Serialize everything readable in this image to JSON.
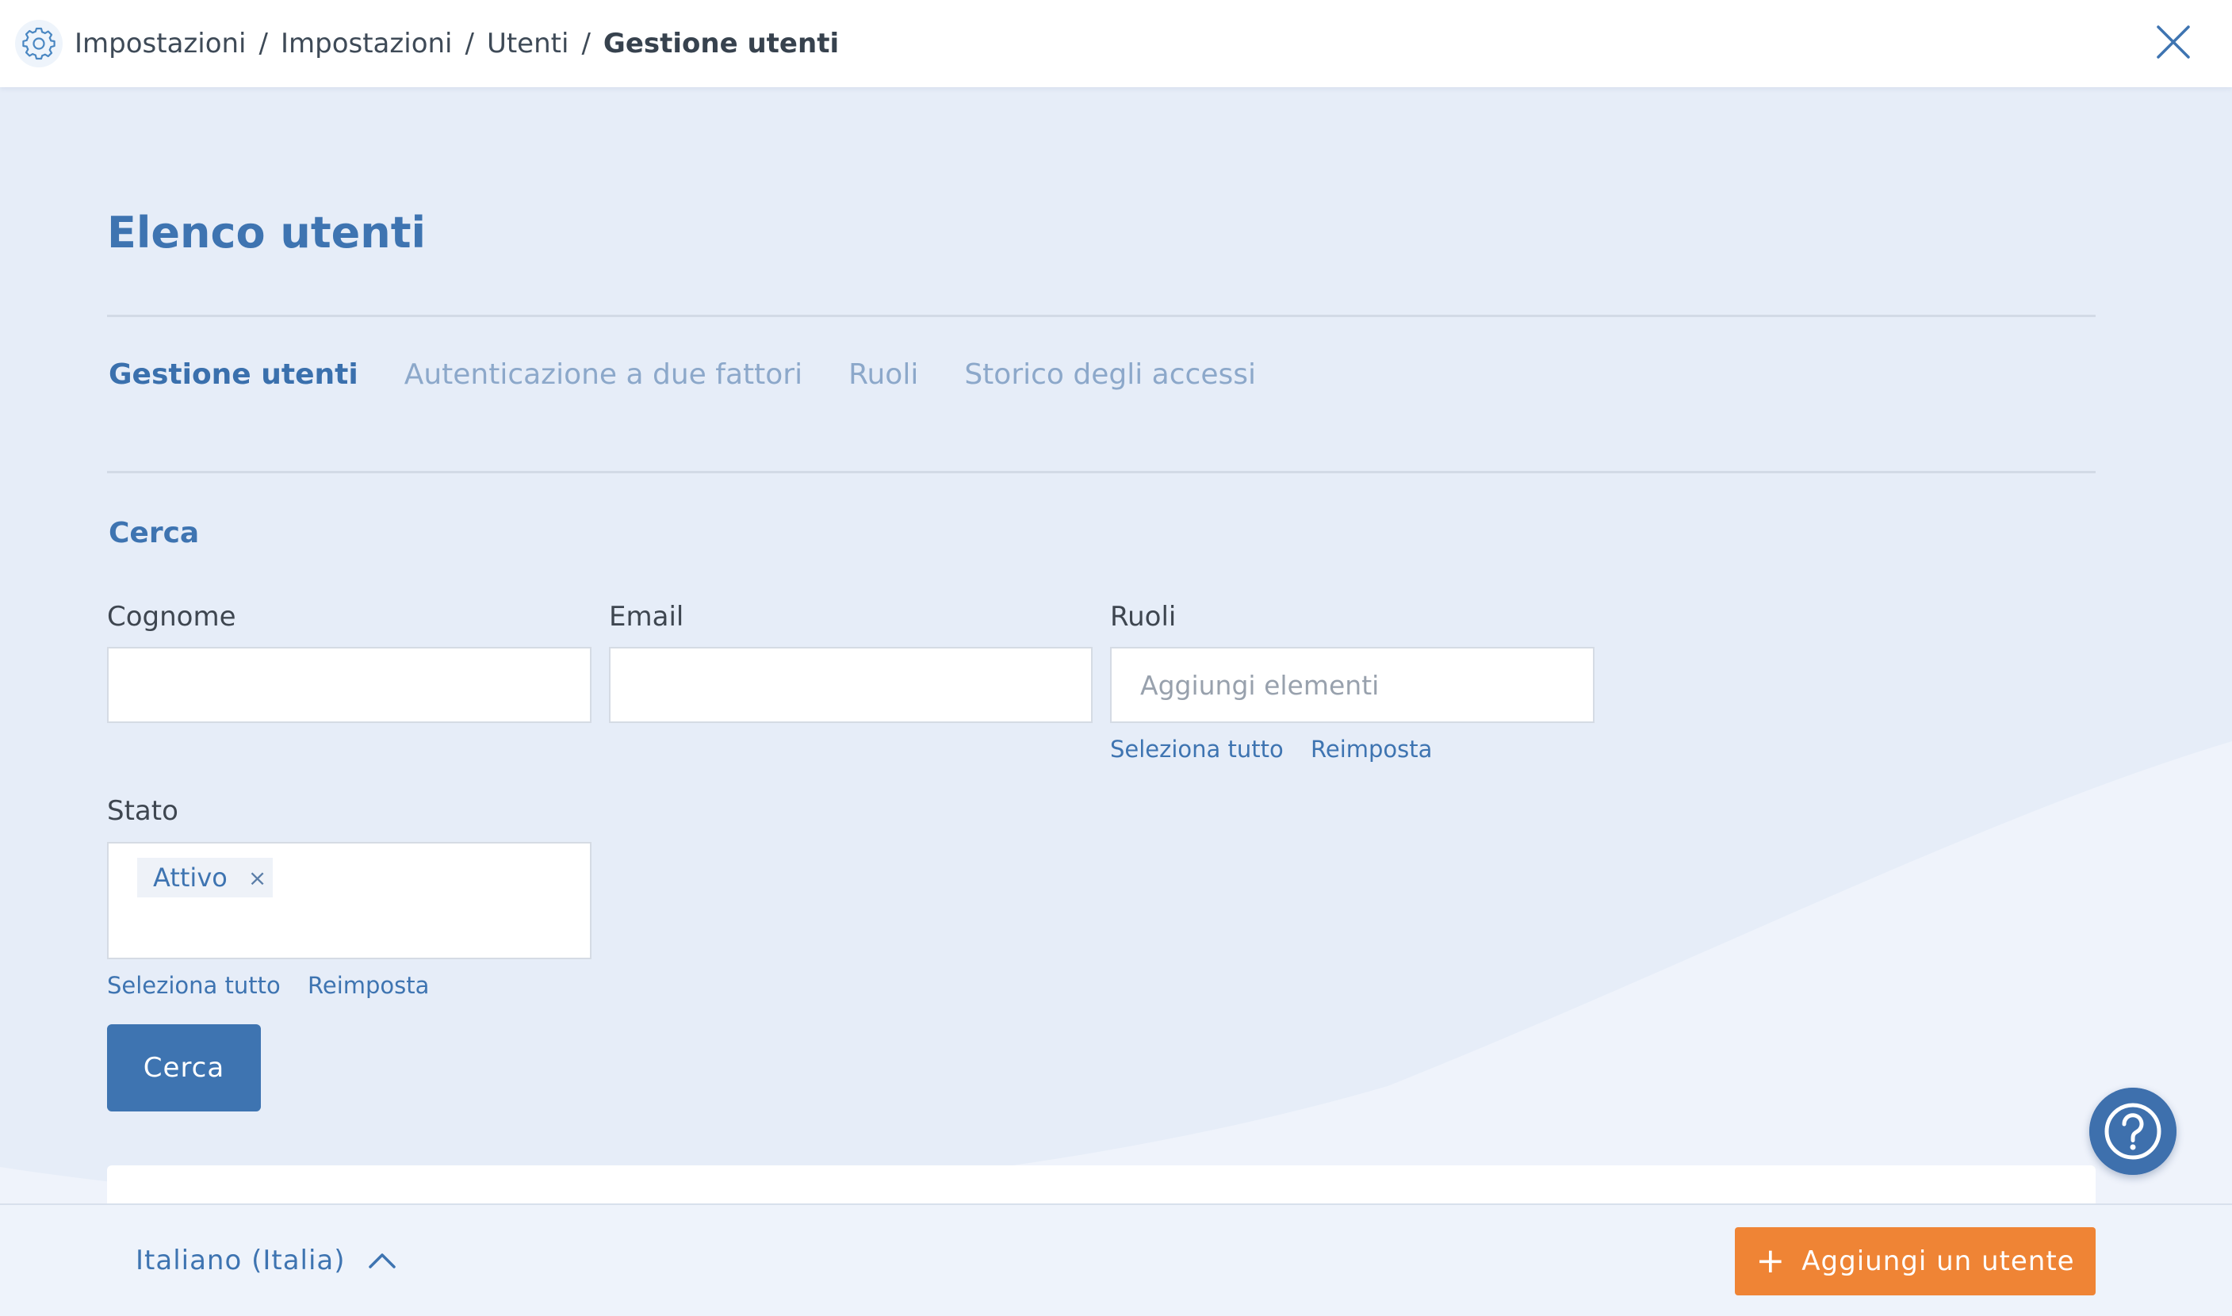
{
  "breadcrumb": {
    "items": [
      "Impostazioni",
      "Impostazioni",
      "Utenti"
    ],
    "separator": "/",
    "current": "Gestione utenti"
  },
  "page": {
    "title": "Elenco utenti"
  },
  "tabs": [
    {
      "label": "Gestione utenti",
      "active": true
    },
    {
      "label": "Autenticazione a due fattori",
      "active": false
    },
    {
      "label": "Ruoli",
      "active": false
    },
    {
      "label": "Storico degli accessi",
      "active": false
    }
  ],
  "search": {
    "section_title": "Cerca",
    "cognome": {
      "label": "Cognome",
      "value": ""
    },
    "email": {
      "label": "Email",
      "value": ""
    },
    "ruoli": {
      "label": "Ruoli",
      "placeholder": "Aggiungi elementi",
      "select_all": "Seleziona tutto",
      "reset": "Reimposta"
    },
    "stato": {
      "label": "Stato",
      "chips": [
        "Attivo"
      ],
      "chip_remove": "×",
      "select_all": "Seleziona tutto",
      "reset": "Reimposta"
    },
    "button_label": "Cerca"
  },
  "footer": {
    "language": "Italiano (Italia)",
    "add_user_label": "Aggiungi un utente",
    "add_user_icon": "+"
  },
  "icons": {
    "settings": "gear-icon",
    "close": "close-icon",
    "help": "question-icon",
    "language_toggle": "chevron-up-icon"
  },
  "colors": {
    "primary": "#3e74b1",
    "accent": "#ef8435",
    "background": "#e6edf8"
  }
}
